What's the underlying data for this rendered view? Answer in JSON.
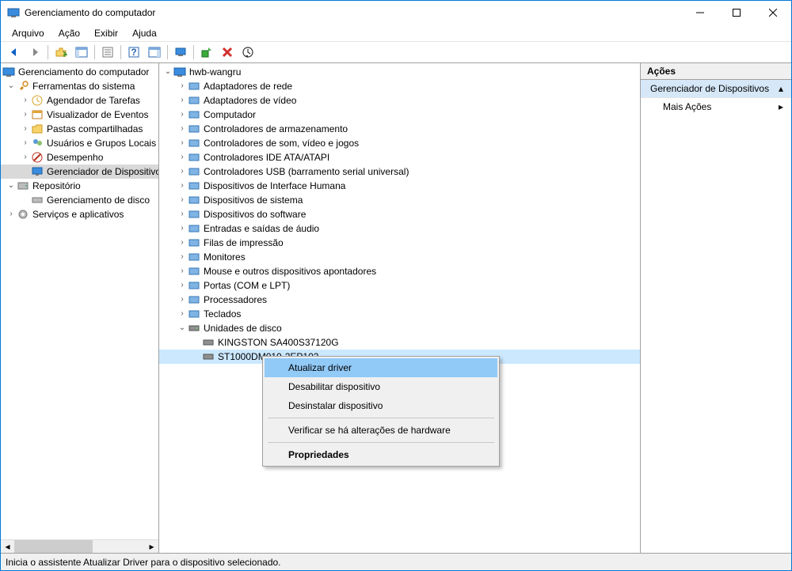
{
  "window": {
    "title": "Gerenciamento do computador"
  },
  "menu": {
    "file": "Arquivo",
    "action": "Ação",
    "view": "Exibir",
    "help": "Ajuda"
  },
  "left_tree": {
    "root": "Gerenciamento do computador",
    "sys_tools": "Ferramentas do sistema",
    "task_sched": "Agendador de Tarefas",
    "event_viewer": "Visualizador de Eventos",
    "shared_folders": "Pastas compartilhadas",
    "users_groups": "Usuários e Grupos Locais",
    "performance": "Desempenho",
    "device_mgr": "Gerenciador de Dispositivos",
    "storage": "Repositório",
    "disk_mgmt": "Gerenciamento de disco",
    "services_apps": "Serviços e aplicativos"
  },
  "mid_tree": {
    "root": "hwb-wangru",
    "items": [
      "Adaptadores de rede",
      "Adaptadores de vídeo",
      "Computador",
      "Controladores de armazenamento",
      "Controladores de som, vídeo e jogos",
      "Controladores IDE ATA/ATAPI",
      "Controladores USB (barramento serial universal)",
      "Dispositivos de Interface Humana",
      "Dispositivos de sistema",
      "Dispositivos do software",
      "Entradas e saídas de áudio",
      "Filas de impressão",
      "Monitores",
      "Mouse e outros dispositivos apontadores",
      "Portas (COM e LPT)",
      "Processadores",
      "Teclados"
    ],
    "disk_drives": "Unidades de disco",
    "disk1": "KINGSTON SA400S37120G",
    "disk2": "ST1000DM010-2EP102"
  },
  "ctx": {
    "update": "Atualizar driver",
    "disable": "Desabilitar dispositivo",
    "uninstall": "Desinstalar dispositivo",
    "scan": "Verificar se há alterações de hardware",
    "props": "Propriedades"
  },
  "actions": {
    "head": "Ações",
    "section": "Gerenciador de Dispositivos",
    "more": "Mais Ações"
  },
  "status": "Inicia o assistente Atualizar Driver para o dispositivo selecionado."
}
